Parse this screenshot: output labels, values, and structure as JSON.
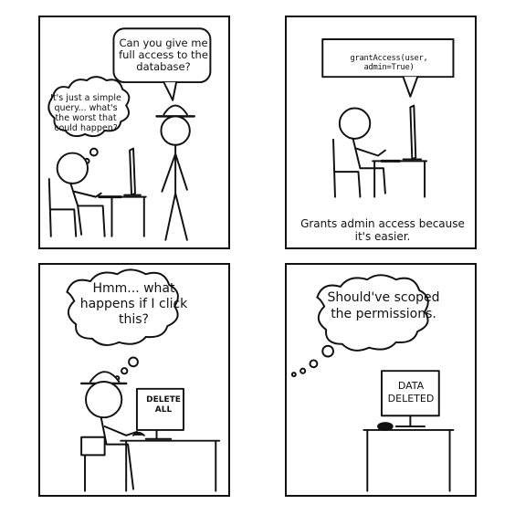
{
  "panels": [
    {
      "speech": "Can you give me full access to the database?",
      "thought": "It's just a simple query... what's the worst that could happen?"
    },
    {
      "code": "grantAccess(user, admin=True)",
      "caption": "Grants admin access because it's easier."
    },
    {
      "thought": "Hmm... what happens if I click this?",
      "screen": "DELETE ALL"
    },
    {
      "thought": "Should've scoped the permissions.",
      "screen": "DATA DELETED"
    }
  ]
}
